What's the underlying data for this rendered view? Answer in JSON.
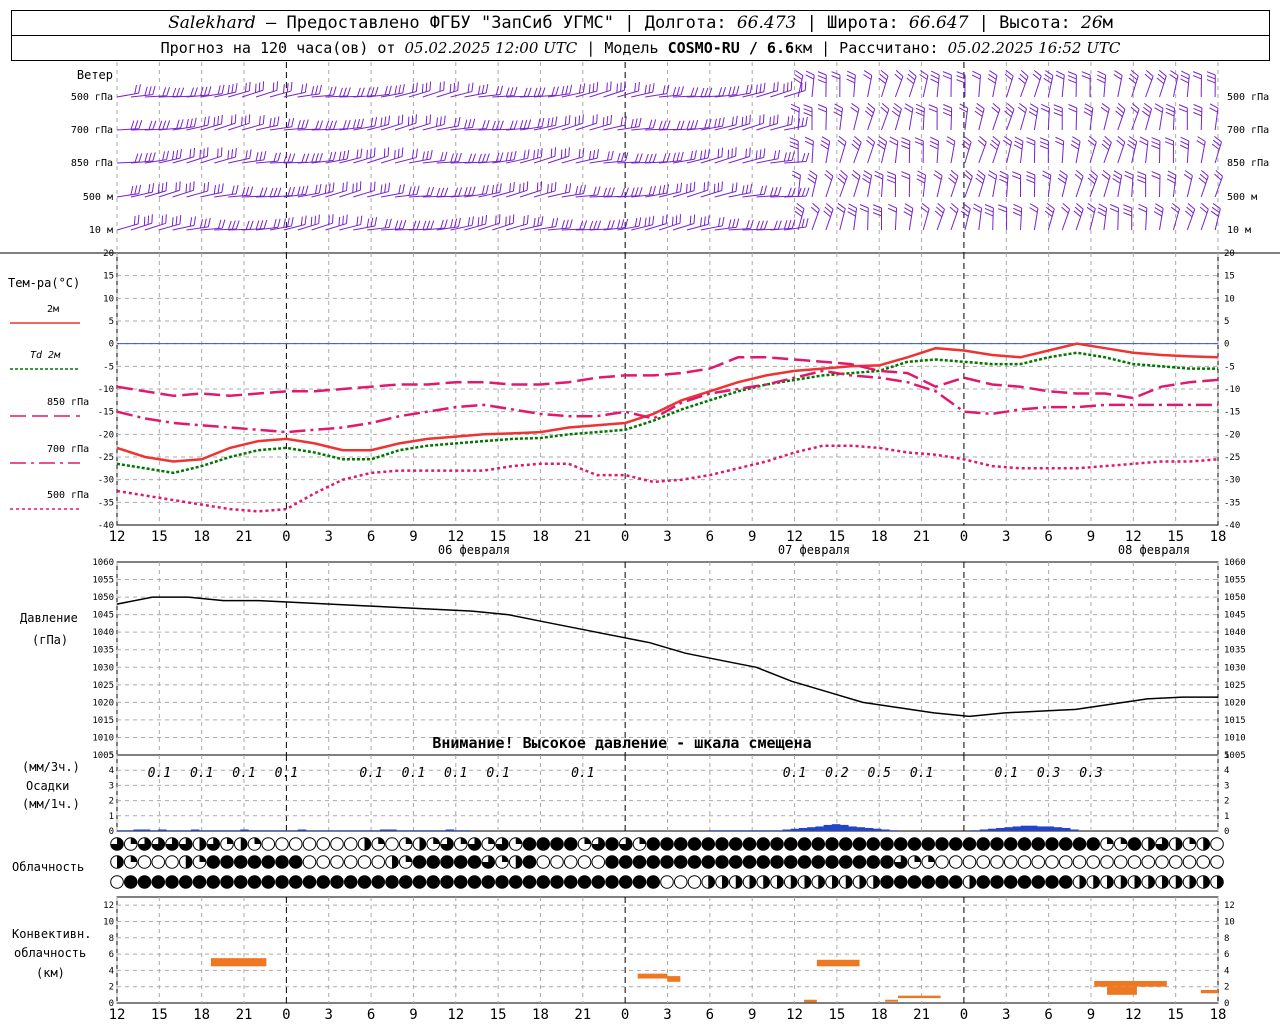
{
  "header": {
    "station": "Salekhard",
    "provider": " – Предоставлено ФГБУ \"ЗапСиб УГМС\" | Долгота: ",
    "lon": "66.473",
    "lat_label": " | Широта: ",
    "lat": "66.647",
    "alt_label": " | Высота: ",
    "alt": "26",
    "alt_unit": "м",
    "forecast_label": "Прогноз на 120 часа(ов) от ",
    "forecast_time": "05.02.2025 12:00 UTC",
    "model_label": " | Модель ",
    "model": "COSMO-RU / 6.6",
    "model_unit": "км",
    "calc_label": " | Рассчитано: ",
    "calc_time": "05.02.2025 16:52 UTC"
  },
  "labels": {
    "wind_title": "Ветер",
    "wind_levels": [
      "500 гПа",
      "700 гПа",
      "850 гПа",
      "500 м",
      "10  м"
    ],
    "temp_title": "Тем-ра(°С)",
    "temp_legend": [
      "2м",
      "Td  2м",
      "850 гПа",
      "700 гПа",
      "500 гПа"
    ],
    "pressure_title": "Давление",
    "pressure_unit": "(гПа)",
    "warning": "Внимание! Высокое давление - шкала смещена",
    "precip_unit1": "(мм/3ч.)",
    "precip_title": "Осадки",
    "precip_unit2": "(мм/1ч.)",
    "cloud_title": "Облачность",
    "conv_title1": "Конвективн.",
    "conv_title2": "облачность",
    "conv_unit": "(км)",
    "dates": [
      "06 февраля",
      "07 февраля",
      "08 февраля"
    ]
  },
  "colors": {
    "t2m": "#ee3333",
    "td2m": "#007700",
    "t850": "#e0186e",
    "t700": "#e0186e",
    "t500": "#e0186e",
    "wind": "#7722cc",
    "pressure": "#000000",
    "precip": "#2244cc",
    "convective": "#ee7722",
    "zero_line": "#3355dd"
  },
  "chart_data": {
    "type": "line",
    "x_ticks": [
      "12",
      "15",
      "18",
      "21",
      "0",
      "3",
      "6",
      "9",
      "12",
      "15",
      "18",
      "21",
      "0",
      "3",
      "6",
      "9",
      "12",
      "15",
      "18",
      "21",
      "0",
      "3",
      "6",
      "9",
      "12",
      "15",
      "18"
    ],
    "wind_layers": [
      "500 гПа",
      "700 гПа",
      "850 гПа",
      "500 м",
      "10 м"
    ],
    "temperature": {
      "ylim": [
        -40,
        20
      ],
      "yticks": [
        -40,
        -35,
        -30,
        -25,
        -20,
        -15,
        -10,
        -5,
        0,
        5,
        10,
        15,
        20
      ],
      "series": [
        {
          "name": "2м",
          "values": [
            -23,
            -25,
            -26,
            -25.5,
            -23,
            -21.5,
            -21,
            -22,
            -23.5,
            -23.5,
            -22,
            -21,
            -20.5,
            -20,
            -19.8,
            -19.5,
            -18.5,
            -18,
            -17.5,
            -15.5,
            -12.5,
            -10.5,
            -8.5,
            -7,
            -6,
            -5.5,
            -5,
            -4.8,
            -3,
            -1,
            -1.5,
            -2.5,
            -3,
            -1.5,
            0,
            -1,
            -2,
            -2.5,
            -2.8,
            -3
          ]
        },
        {
          "name": "Td 2м",
          "values": [
            -26.5,
            -27.5,
            -28.5,
            -27,
            -25,
            -23.5,
            -23,
            -24,
            -25.5,
            -25.5,
            -23.5,
            -22.5,
            -22,
            -21.5,
            -21,
            -20.8,
            -20,
            -19.5,
            -19,
            -17,
            -14.5,
            -12.5,
            -10.5,
            -9,
            -8,
            -7,
            -6.5,
            -6,
            -4,
            -3.5,
            -4,
            -4.5,
            -4.5,
            -3,
            -2,
            -3,
            -4.5,
            -5,
            -5.5,
            -5.5
          ]
        },
        {
          "name": "850 гПа",
          "values": [
            -9.5,
            -10.5,
            -11.5,
            -11,
            -11.5,
            -11,
            -10.5,
            -10.5,
            -10,
            -9.5,
            -9,
            -9,
            -8.5,
            -8.5,
            -9,
            -9,
            -8.5,
            -7.5,
            -7,
            -7,
            -6.5,
            -5.5,
            -3,
            -3,
            -3.5,
            -4,
            -4.5,
            -6,
            -6.5,
            -9.5,
            -7.5,
            -9,
            -9.5,
            -10.5,
            -11,
            -11,
            -12,
            -9.5,
            -8.5,
            -8
          ]
        },
        {
          "name": "700 гПа",
          "values": [
            -15,
            -16.5,
            -17.5,
            -18,
            -18.5,
            -19,
            -19.5,
            -19,
            -18.5,
            -17.5,
            -16,
            -15,
            -14,
            -13.5,
            -14.5,
            -15.5,
            -16,
            -16,
            -15,
            -16.5,
            -13,
            -11,
            -10,
            -9,
            -7.5,
            -6,
            -7,
            -7.5,
            -8.5,
            -10.5,
            -15,
            -15.5,
            -14.5,
            -14,
            -14,
            -13.5,
            -13.5,
            -13.5,
            -13.5,
            -13.5
          ]
        },
        {
          "name": "500 гПа",
          "values": [
            -32.5,
            -33.5,
            -34.5,
            -35.5,
            -36.5,
            -37,
            -36.5,
            -33,
            -30,
            -28.5,
            -28,
            -28,
            -28,
            -28,
            -27,
            -26.5,
            -26.5,
            -29,
            -29,
            -30.5,
            -30,
            -29,
            -27.5,
            -26,
            -24,
            -22.5,
            -22.5,
            -23,
            -24,
            -24.5,
            -25.5,
            -27,
            -27.5,
            -27.5,
            -27.5,
            -27,
            -26.5,
            -26,
            -26,
            -25.5
          ]
        }
      ]
    },
    "pressure": {
      "ylim": [
        1005,
        1060
      ],
      "yticks": [
        1005,
        1010,
        1015,
        1020,
        1025,
        1030,
        1035,
        1040,
        1045,
        1050,
        1055,
        1060
      ],
      "values": [
        1048,
        1050,
        1050,
        1049,
        1049,
        1048.5,
        1048,
        1047.5,
        1047,
        1046.5,
        1046,
        1045,
        1043,
        1041,
        1039,
        1037,
        1034,
        1032,
        1030,
        1026,
        1023,
        1020,
        1018.5,
        1017,
        1016,
        1017,
        1017.5,
        1018,
        1019.5,
        1021,
        1021.5,
        1021.5
      ]
    },
    "precipitation": {
      "ylim": [
        0,
        5
      ],
      "yticks": [
        0,
        1,
        2,
        3,
        4,
        5
      ],
      "values_3h": [
        {
          "hour": 1,
          "value": "0.1"
        },
        {
          "hour": 2,
          "value": "0.1"
        },
        {
          "hour": 3,
          "value": "0.1"
        },
        {
          "hour": 4,
          "value": "0.1"
        },
        {
          "hour": 6,
          "value": "0.1"
        },
        {
          "hour": 7,
          "value": "0.1"
        },
        {
          "hour": 8,
          "value": "0.1"
        },
        {
          "hour": 9,
          "value": "0.1"
        },
        {
          "hour": 11,
          "value": "0.1"
        },
        {
          "hour": 16,
          "value": "0.1"
        },
        {
          "hour": 17,
          "value": "0.2"
        },
        {
          "hour": 18,
          "value": "0.5"
        },
        {
          "hour": 19,
          "value": "0.1"
        },
        {
          "hour": 21,
          "value": "0.1"
        },
        {
          "hour": 22,
          "value": "0.3"
        },
        {
          "hour": 23,
          "value": "0.3"
        }
      ],
      "hourly": [
        0.05,
        0.05,
        0.1,
        0.1,
        0.05,
        0.1,
        0.05,
        0.05,
        0.05,
        0.1,
        0.05,
        0.05,
        0.05,
        0.05,
        0.05,
        0.1,
        0.05,
        0.05,
        0.05,
        0.05,
        0.05,
        0.05,
        0.1,
        0.05,
        0.05,
        0.05,
        0.05,
        0.05,
        0.05,
        0.05,
        0.05,
        0.05,
        0.1,
        0.1,
        0.05,
        0.05,
        0.05,
        0.05,
        0.05,
        0.05,
        0.1,
        0.05,
        0.05,
        0,
        0,
        0,
        0,
        0,
        0,
        0,
        0,
        0,
        0,
        0,
        0,
        0,
        0,
        0,
        0,
        0,
        0,
        0,
        0,
        0,
        0,
        0,
        0,
        0,
        0,
        0,
        0,
        0,
        0.05,
        0.05,
        0.05,
        0.05,
        0.05,
        0.05,
        0.05,
        0.05,
        0.05,
        0.1,
        0.15,
        0.2,
        0.25,
        0.3,
        0.4,
        0.45,
        0.4,
        0.3,
        0.25,
        0.2,
        0.15,
        0.1,
        0.05,
        0,
        0,
        0,
        0,
        0,
        0,
        0,
        0,
        0,
        0.05,
        0.1,
        0.15,
        0.2,
        0.25,
        0.3,
        0.35,
        0.35,
        0.3,
        0.3,
        0.25,
        0.2,
        0.1,
        0,
        0,
        0,
        0,
        0,
        0,
        0,
        0,
        0,
        0,
        0,
        0,
        0,
        0,
        0,
        0,
        0
      ]
    },
    "convective_cloud": {
      "ylim": [
        0,
        13
      ],
      "yticks": [
        0,
        2,
        4,
        6,
        8,
        10,
        12
      ],
      "segments": [
        {
          "t0": 22,
          "t1": 35,
          "bottom": 4.5,
          "top": 5.5
        },
        {
          "t0": 122,
          "t1": 129,
          "bottom": 3.0,
          "top": 3.6
        },
        {
          "t0": 129,
          "t1": 132,
          "bottom": 2.6,
          "top": 3.3
        },
        {
          "t0": 164,
          "t1": 174,
          "bottom": 4.5,
          "top": 5.3
        },
        {
          "t0": 161,
          "t1": 164,
          "bottom": 0.1,
          "top": 0.4
        },
        {
          "t0": 180,
          "t1": 183,
          "bottom": 0.2,
          "top": 0.4
        },
        {
          "t0": 183,
          "t1": 193,
          "bottom": 0.6,
          "top": 0.9
        },
        {
          "t0": 229,
          "t1": 246,
          "bottom": 2.0,
          "top": 2.7
        },
        {
          "t0": 232,
          "t1": 239,
          "bottom": 1.0,
          "top": 2.0
        },
        {
          "t0": 254,
          "t1": 258,
          "bottom": 1.2,
          "top": 1.6
        }
      ]
    },
    "cloudiness": {
      "rows": [
        "upper",
        "middle",
        "lower"
      ],
      "upper": "RQRRRRHRQHQ0000000HQ0QHQRQRQRQFFFFQRFRQFFFFFFFFFFFFFFFFFFFFFFFFFFFFFFFFFQQFHRHQH0000000000000000000",
      "middle": "HQ000HQFFFFFFF000000HQFFFFFRQHF00000FFFFFFFFFFFFFFFFFFFFFRQQ000000000000000000000FH00000000000",
      "lower": "0FFFFFFFFFFFFFFFFFFFFFFFFFFFFFFFFFFFFFFF000HHHHHHHHHHHHHFFFFFFHFFFFFFFHHHHHHHHHHHHHHFH0QRHQ0000"
    }
  }
}
